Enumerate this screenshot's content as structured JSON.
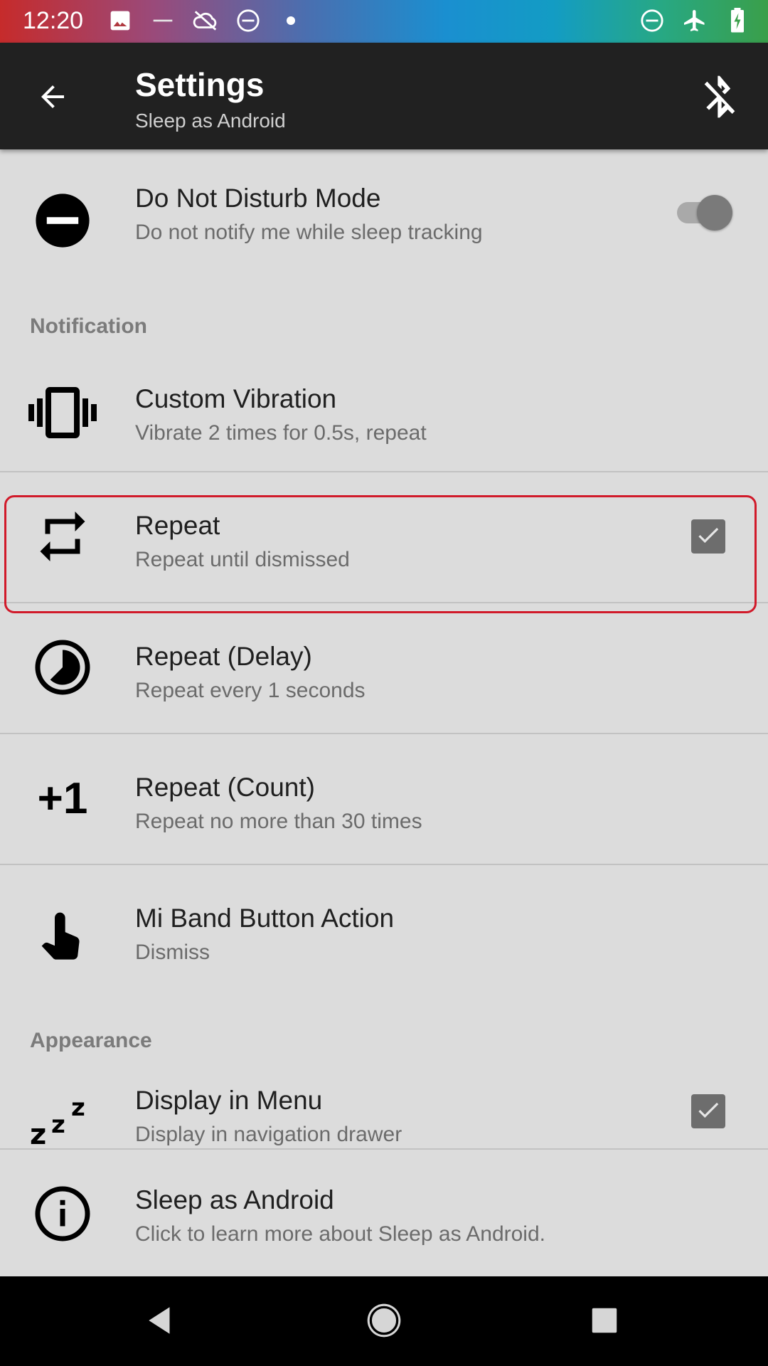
{
  "status_bar": {
    "time": "12:20",
    "left_icons": [
      "image-icon",
      "dash-icon",
      "cloud-off-icon",
      "dnd-icon",
      "dot-icon"
    ],
    "right_icons": [
      "dnd-icon",
      "airplane-icon",
      "battery-icon"
    ]
  },
  "app_bar": {
    "title": "Settings",
    "subtitle": "Sleep as Android",
    "back_icon": "arrow-back-icon",
    "action_icon": "bluetooth-off-icon"
  },
  "settings": {
    "dnd": {
      "title": "Do Not Disturb Mode",
      "summary": "Do not notify me while sleep tracking",
      "toggle_on": true
    },
    "notification_header": "Notification",
    "custom_vibration": {
      "title": "Custom Vibration",
      "summary": "Vibrate 2 times for 0.5s, repeat"
    },
    "repeat": {
      "title": "Repeat",
      "summary": "Repeat until dismissed",
      "checked": true
    },
    "repeat_delay": {
      "title": "Repeat (Delay)",
      "summary": "Repeat every 1 seconds"
    },
    "repeat_count": {
      "title": "Repeat (Count)",
      "summary": "Repeat no more than 30 times",
      "icon_text": "+1"
    },
    "mi_band": {
      "title": "Mi Band Button Action",
      "summary": "Dismiss"
    },
    "appearance_header": "Appearance",
    "display_menu": {
      "title": "Display in Menu",
      "summary": "Display in navigation drawer",
      "checked": true
    }
  },
  "info": {
    "title": "Sleep as Android",
    "summary": "Click to learn more about Sleep as Android."
  },
  "highlight_color": "#d11a2a"
}
